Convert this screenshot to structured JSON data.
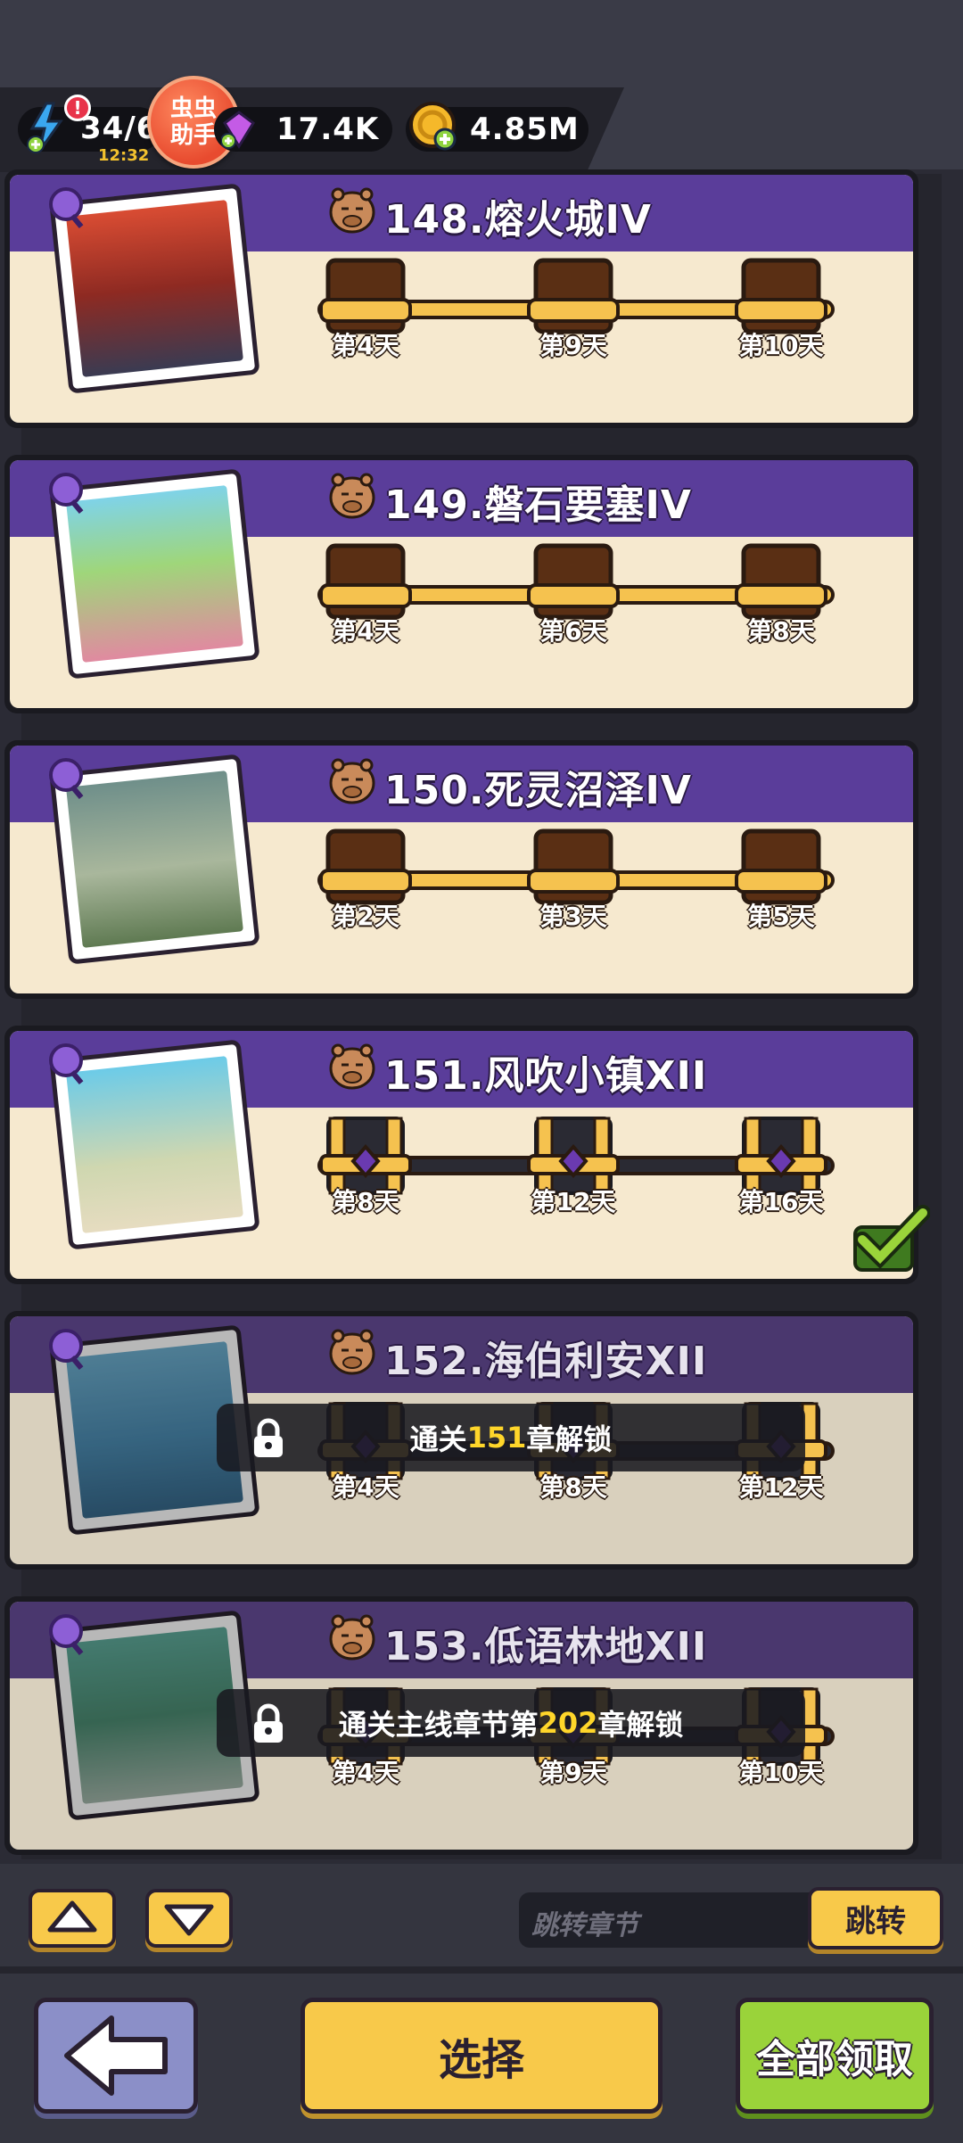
{
  "resources": {
    "energy": "34/6",
    "energy_timer": "12:32",
    "alert": "!",
    "gems": "17.4K",
    "coins": "4.85M"
  },
  "helper": {
    "line1": "虫虫",
    "line2": "助手"
  },
  "chapters": [
    {
      "title": "148.熔火城IV",
      "days": [
        "第4天",
        "第9天",
        "第10天"
      ],
      "locked": false
    },
    {
      "title": "149.磐石要塞IV",
      "days": [
        "第4天",
        "第6天",
        "第8天"
      ],
      "locked": false
    },
    {
      "title": "150.死灵沼泽IV",
      "days": [
        "第2天",
        "第3天",
        "第5天"
      ],
      "locked": false
    },
    {
      "title": "151.风吹小镇XII",
      "days": [
        "第8天",
        "第12天",
        "第16天"
      ],
      "locked": false
    },
    {
      "title": "152.海伯利安XII",
      "days": [
        "第4天",
        "第8天",
        "第12天"
      ],
      "locked": true,
      "lock_prefix": "通关",
      "lock_number": "151",
      "lock_suffix": "章解锁"
    },
    {
      "title": "153.低语林地XII",
      "days": [
        "第4天",
        "第9天",
        "第10天"
      ],
      "locked": true,
      "lock_prefix": "通关主线章节第",
      "lock_number": "202",
      "lock_suffix": "章解锁"
    }
  ],
  "jump": {
    "placeholder": "跳转章节",
    "button": "跳转"
  },
  "buttons": {
    "select": "选择",
    "claim_all": "全部领取"
  },
  "colors": {
    "accent_yellow": "#f8c94a",
    "header_purple": "#5a3d9a",
    "claim_green": "#9ad33a",
    "highlight": "#ffd62a"
  },
  "icons": [
    "energy-icon",
    "gem-icon",
    "coin-icon",
    "capybara-icon",
    "chest-icon",
    "lock-icon",
    "check-icon",
    "arrow-up-icon",
    "arrow-down-icon",
    "back-arrow-icon"
  ]
}
